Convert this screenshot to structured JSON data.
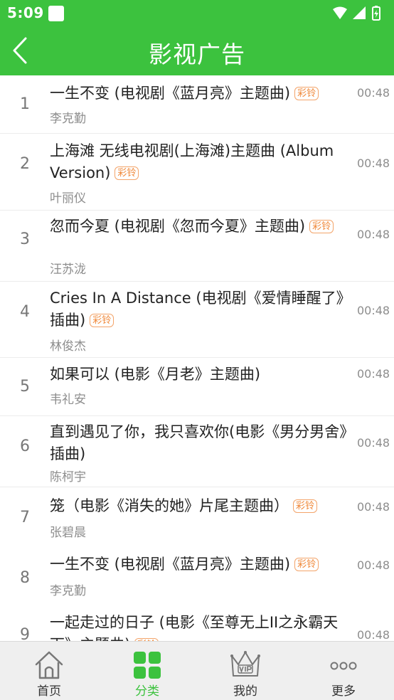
{
  "status_bar": {
    "time": "5:09"
  },
  "header": {
    "title": "影视广告"
  },
  "ringtone_badge": "彩铃",
  "songs": [
    {
      "index": "1",
      "title": "一生不变 (电视剧《蓝月亮》主题曲)",
      "artist": "李克勤",
      "duration": "00:48",
      "ringtone": true
    },
    {
      "index": "2",
      "title": "上海滩 无线电视剧(上海滩)主题曲 (Album Version)",
      "artist": "叶丽仪",
      "duration": "00:48",
      "ringtone": true
    },
    {
      "index": "3",
      "title": "忽而今夏 (电视剧《忽而今夏》主题曲)",
      "artist": "汪苏泷",
      "duration": "00:48",
      "ringtone": true
    },
    {
      "index": "4",
      "title": "Cries In A Distance (电视剧《爱情睡醒了》插曲)",
      "artist": "林俊杰",
      "duration": "00:48",
      "ringtone": true
    },
    {
      "index": "5",
      "title": "如果可以 (电影《月老》主题曲)",
      "artist": "韦礼安",
      "duration": "00:48",
      "ringtone": false
    },
    {
      "index": "6",
      "title": "直到遇见了你，我只喜欢你(电影《男分男舍》插曲)",
      "artist": "陈柯宇",
      "duration": "00:48",
      "ringtone": false
    },
    {
      "index": "7",
      "title": "笼（电影《消失的她》片尾主题曲）",
      "artist": "张碧晨",
      "duration": "00:48",
      "ringtone": true
    },
    {
      "index": "8",
      "title": "一生不变 (电视剧《蓝月亮》主题曲)",
      "artist": "李克勤",
      "duration": "00:48",
      "ringtone": true
    },
    {
      "index": "9",
      "title": "一起走过的日子 (电影《至尊无上II之永霸天下》主题曲)",
      "artist": "",
      "duration": "00:48",
      "ringtone": true
    }
  ],
  "tabs": [
    {
      "label": "首页",
      "icon": "home-icon",
      "active": false
    },
    {
      "label": "分类",
      "icon": "category-grid-icon",
      "active": true
    },
    {
      "label": "我的",
      "icon": "vip-crown-icon",
      "active": false
    },
    {
      "label": "更多",
      "icon": "more-dots-icon",
      "active": false
    }
  ],
  "colors": {
    "accent": "#3cc23e",
    "badge": "#f08a3c",
    "tab_bar": "#efefef"
  }
}
